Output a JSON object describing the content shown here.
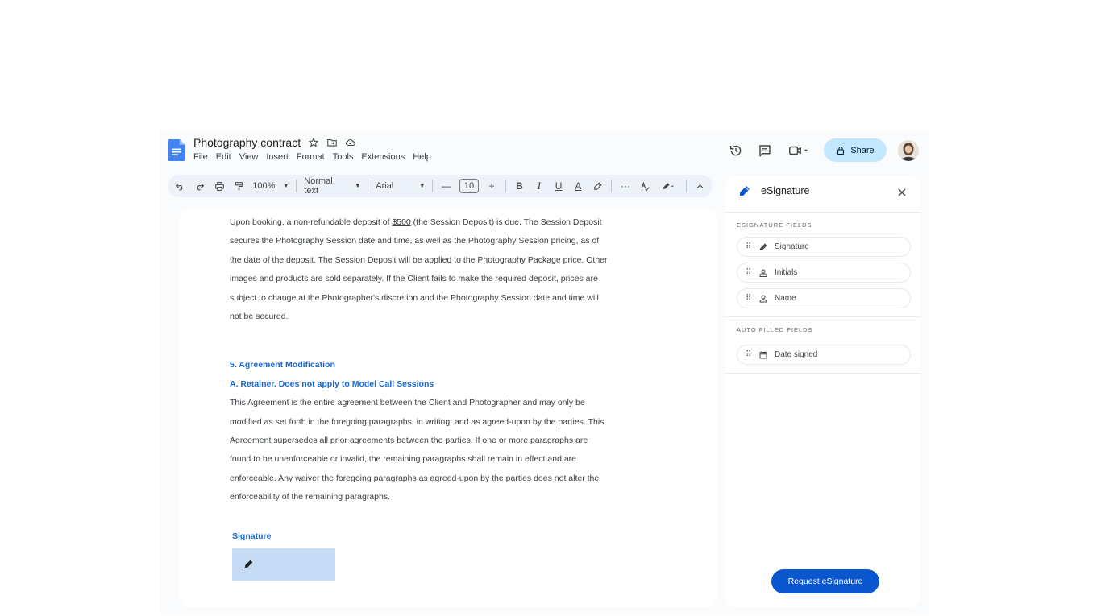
{
  "document": {
    "title": "Photography contract",
    "menu": [
      "File",
      "Edit",
      "View",
      "Insert",
      "Format",
      "Tools",
      "Extensions",
      "Help"
    ]
  },
  "header": {
    "share_label": "Share"
  },
  "toolbar": {
    "zoom": "100%",
    "style": "Normal text",
    "font": "Arial",
    "font_size": "10",
    "bold": "B",
    "italic": "I",
    "underline": "U",
    "text_color": "A",
    "more": "···"
  },
  "content": {
    "para1_before": "Upon booking, a non-refundable deposit of ",
    "para1_amount": "$500",
    "para1_after": " (the Session Deposit) is due. The Session Deposit secures the Photography Session date and time, as well as the Photography Session pricing, as of the date of the deposit. The Session Deposit will be applied to the Photography Package price. Other images and products are sold separately. If the Client fails to make the required deposit, prices are subject to change at the Photographer's discretion and the Photography Session date and time will not be secured.",
    "heading1": "5. Agreement Modification",
    "heading2": "A. Retainer.  Does not apply to Model Call Sessions",
    "para2": "This Agreement is the entire agreement between the Client and Photographer and may only be modified as set forth in the foregoing paragraphs, in writing, and as agreed-upon by the parties.  This Agreement supersedes all prior agreements between the parties. If one or more paragraphs are found to be unenforceable or invalid, the remaining paragraphs shall remain in effect and are enforceable. Any waiver the foregoing paragraphs as agreed-upon by the parties does not alter the enforceability of the remaining paragraphs.",
    "signature_label": "Signature"
  },
  "panel": {
    "title": "eSignature",
    "esig_section": "ESIGNATURE FIELDS",
    "esig_fields": [
      "Signature",
      "Initials",
      "Name"
    ],
    "auto_section": "AUTO FILLED FIELDS",
    "auto_fields": [
      "Date signed"
    ],
    "request_label": "Request eSignature"
  },
  "colors": {
    "accent": "#0b57d0",
    "share_bg": "#c2e7ff",
    "heading_blue": "#1967d2",
    "signature_box": "#c6dcf6",
    "docs_blue": "#4285f4"
  }
}
